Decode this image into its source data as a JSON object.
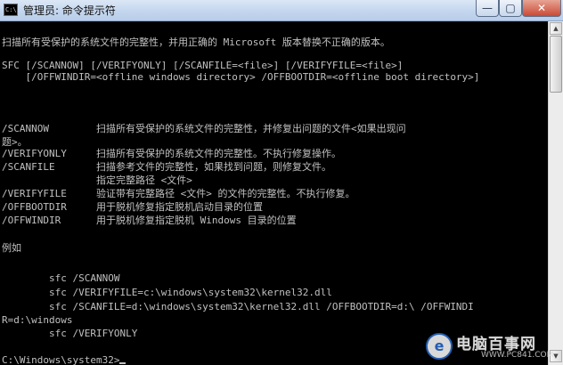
{
  "window": {
    "icon_text": "C:\\",
    "title": "管理员: 命令提示符",
    "buttons": {
      "minimize": "—",
      "maximize": "▢",
      "close": "✕"
    }
  },
  "console": {
    "lines": [
      "扫描所有受保护的系统文件的完整性，并用正确的 Microsoft 版本替换不正确的版本。",
      "",
      "SFC [/SCANNOW] [/VERIFYONLY] [/SCANFILE=<file>] [/VERIFYFILE=<file>]",
      "    [/OFFWINDIR=<offline windows directory> /OFFBOOTDIR=<offline boot directory>]",
      "",
      "/SCANNOW        扫描所有受保护的系统文件的完整性，并修复出问题的文件<如果出现问",
      "题>。",
      "/VERIFYONLY     扫描所有受保护的系统文件的完整性。不执行修复操作。",
      "/SCANFILE       扫描参考文件的完整性，如果找到问题，则修复文件。",
      "                指定完整路径 <文件>",
      "/VERIFYFILE     验证带有完整路径 <文件> 的文件的完整性。不执行修复。",
      "/OFFBOOTDIR     用于脱机修复指定脱机启动目录的位置",
      "/OFFWINDIR      用于脱机修复指定脱机 Windows 目录的位置",
      "",
      "例如",
      "",
      "        sfc /SCANNOW",
      "        sfc /VERIFYFILE=c:\\windows\\system32\\kernel32.dll",
      "        sfc /SCANFILE=d:\\windows\\system32\\kernel32.dll /OFFBOOTDIR=d:\\ /OFFWINDI",
      "R=d:\\windows",
      "        sfc /VERIFYONLY",
      "",
      "C:\\Windows\\system32>"
    ]
  },
  "watermark": {
    "logo_char": "e",
    "title": "电脑百事网",
    "url": "WWW.PC841.COM"
  },
  "colors": {
    "console_bg": "#000000",
    "console_fg": "#c0c0c0",
    "titlebar": "#c4d6ee",
    "close_button": "#c94a35"
  }
}
